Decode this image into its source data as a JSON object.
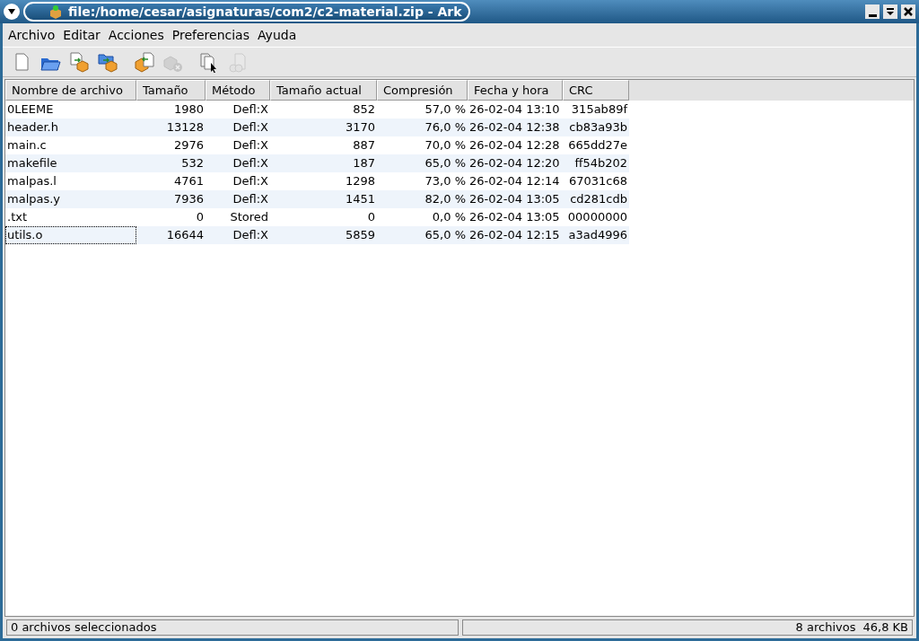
{
  "window": {
    "title": "file:/home/cesar/asignaturas/com2/c2-material.zip - Ark"
  },
  "menu": [
    "Archivo",
    "Editar",
    "Acciones",
    "Preferencias",
    "Ayuda"
  ],
  "toolbar": [
    {
      "kind": "new",
      "disabled": false
    },
    {
      "kind": "open",
      "disabled": false
    },
    {
      "kind": "add-file",
      "disabled": false
    },
    {
      "kind": "add-folder",
      "disabled": false
    },
    {
      "kind": "extract",
      "disabled": false
    },
    {
      "kind": "delete",
      "disabled": true
    },
    {
      "kind": "view",
      "disabled": false
    },
    {
      "kind": "open-with",
      "disabled": true
    }
  ],
  "table": {
    "columns": [
      "Nombre de archivo",
      "Tamaño",
      "Método",
      "Tamaño actual",
      "Compresión",
      "Fecha y hora",
      "CRC"
    ],
    "rows": [
      {
        "cells": [
          "0LEEME",
          "1980",
          "Defl:X",
          "852",
          "57,0 %",
          "26-02-04 13:10",
          "315ab89f"
        ],
        "focused": false
      },
      {
        "cells": [
          "header.h",
          "13128",
          "Defl:X",
          "3170",
          "76,0 %",
          "26-02-04 12:38",
          "cb83a93b"
        ],
        "focused": false
      },
      {
        "cells": [
          "main.c",
          "2976",
          "Defl:X",
          "887",
          "70,0 %",
          "26-02-04 12:28",
          "665dd27e"
        ],
        "focused": false
      },
      {
        "cells": [
          "makefile",
          "532",
          "Defl:X",
          "187",
          "65,0 %",
          "26-02-04 12:20",
          "ff54b202"
        ],
        "focused": false
      },
      {
        "cells": [
          "malpas.l",
          "4761",
          "Defl:X",
          "1298",
          "73,0 %",
          "26-02-04 12:14",
          "67031c68"
        ],
        "focused": false
      },
      {
        "cells": [
          "malpas.y",
          "7936",
          "Defl:X",
          "1451",
          "82,0 %",
          "26-02-04 13:05",
          "cd281cdb"
        ],
        "focused": false
      },
      {
        "cells": [
          ".txt",
          "0",
          "Stored",
          "0",
          "0,0 %",
          "26-02-04 13:05",
          "00000000"
        ],
        "focused": false
      },
      {
        "cells": [
          "utils.o",
          "16644",
          "Defl:X",
          "5859",
          "65,0 %",
          "26-02-04 12:15",
          "a3ad4996"
        ],
        "focused": true
      }
    ]
  },
  "status_bar": {
    "left": "0 archivos seleccionados",
    "count": "8 archivos",
    "size": "46,8 KB"
  }
}
